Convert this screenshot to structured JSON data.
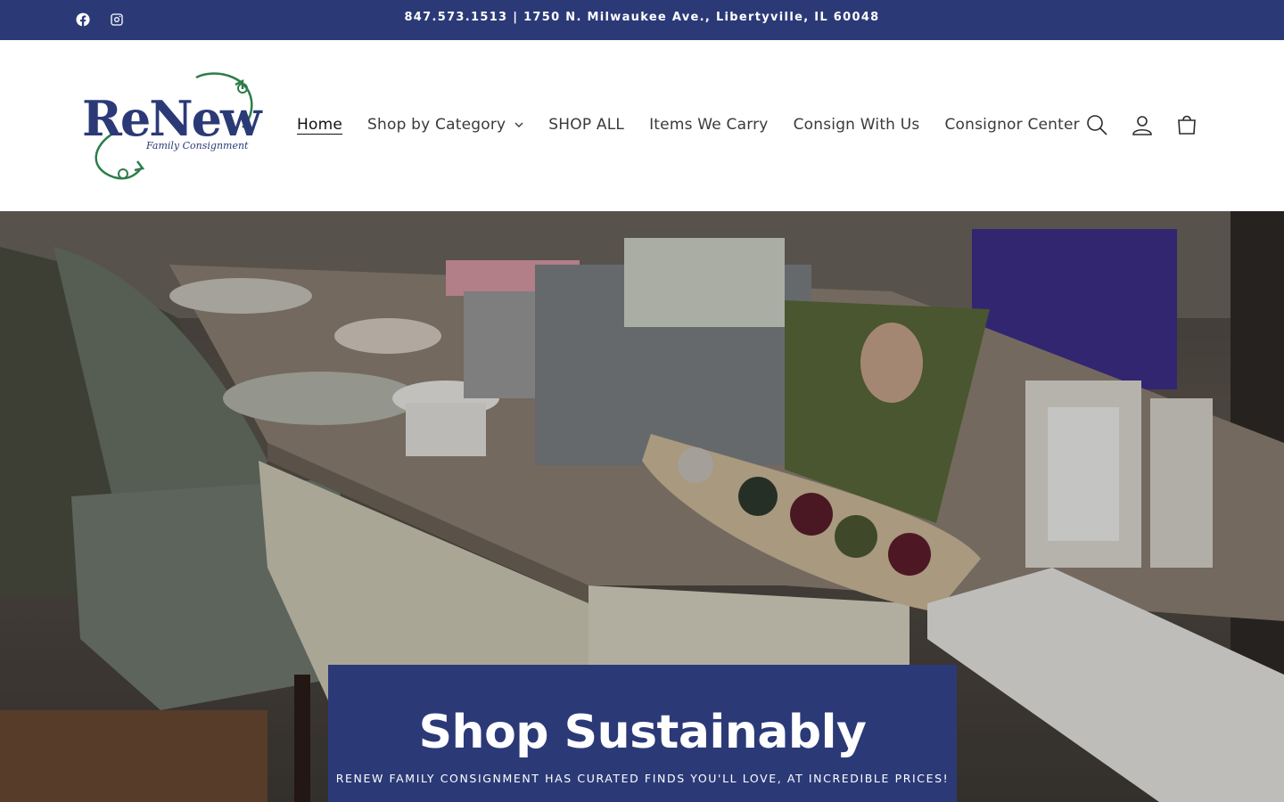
{
  "topbar": {
    "announcement": "847.573.1513 | 1750 N. Milwaukee Ave., Libertyville, IL 60048",
    "social": [
      {
        "icon": "facebook-icon"
      },
      {
        "icon": "instagram-icon"
      }
    ]
  },
  "header": {
    "logo": {
      "word": "ReNew",
      "tagline": "Family Consignment"
    },
    "nav": {
      "home": "Home",
      "shop_by_category": "Shop by Category",
      "shop_all": "SHOP ALL",
      "items_we_carry": "Items We Carry",
      "consign_with_us": "Consign With Us",
      "consignor_center": "Consignor Center"
    },
    "icons": [
      "search-icon",
      "account-icon",
      "cart-icon"
    ]
  },
  "hero": {
    "title": "Shop Sustainably",
    "subtitle": "RENEW FAMILY CONSIGNMENT HAS CURATED FINDS YOU'LL LOVE, AT INCREDIBLE PRICES!"
  },
  "colors": {
    "brand_navy": "#2b3a77",
    "logo_green": "#2e7d4a",
    "header_bg": "#ffffff"
  }
}
